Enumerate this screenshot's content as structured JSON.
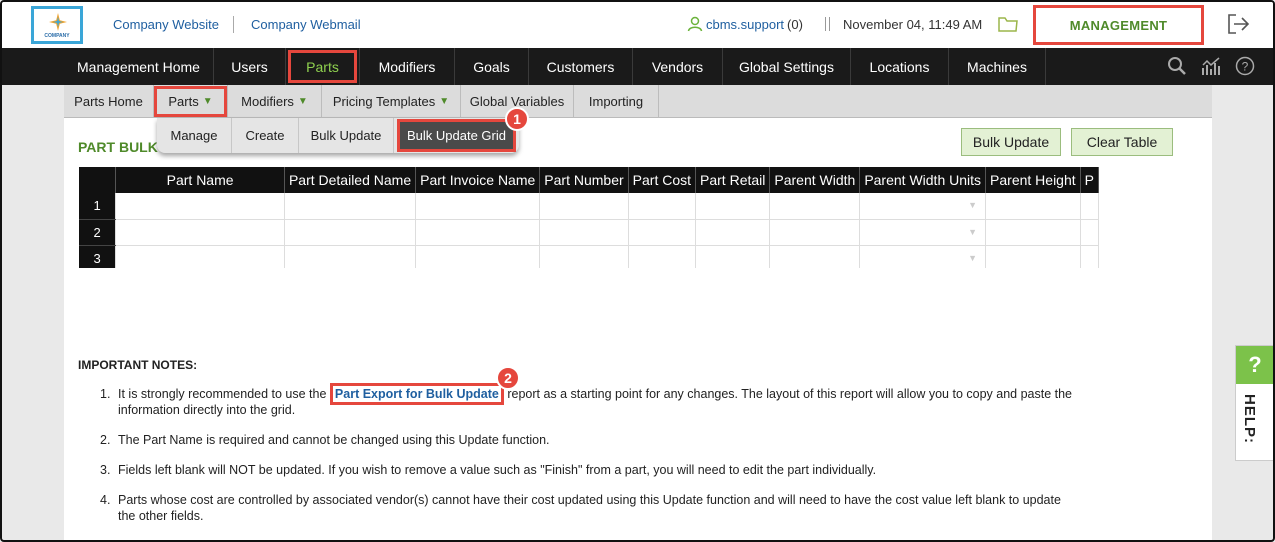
{
  "header": {
    "logo_text": "COMPANY",
    "links": [
      "Company Website",
      "Company Webmail"
    ],
    "user_name": "cbms.support",
    "user_count": "(0)",
    "datetime": "November 04, 11:49 AM",
    "management_label": "MANAGEMENT"
  },
  "mainnav": {
    "items": [
      "Management Home",
      "Users",
      "Parts",
      "Modifiers",
      "Goals",
      "Customers",
      "Vendors",
      "Global Settings",
      "Locations",
      "Machines"
    ],
    "active": "Parts"
  },
  "subnav": {
    "items": [
      "Parts Home",
      "Parts",
      "Modifiers",
      "Pricing Templates",
      "Global Variables",
      "Importing"
    ]
  },
  "dropdown": {
    "items": [
      "Manage",
      "Create",
      "Bulk Update",
      "Bulk Update Grid"
    ],
    "active": "Bulk Update Grid"
  },
  "page": {
    "title": "PART BULK",
    "bulk_update_button": "Bulk Update",
    "clear_table_button": "Clear Table"
  },
  "grid": {
    "columns": [
      "Part Name",
      "Part Detailed Name",
      "Part Invoice Name",
      "Part Number",
      "Part Cost",
      "Part Retail",
      "Parent Width",
      "Parent Width Units",
      "Parent Height",
      "P"
    ],
    "rows": [
      "1",
      "2",
      "3"
    ]
  },
  "notes": {
    "title": "IMPORTANT NOTES:",
    "items": [
      {
        "num": "1.",
        "before": "It is strongly recommended to use the",
        "link": "Part Export for Bulk Update",
        "after": "report as a starting point for any changes. The layout of this report will allow you to copy and paste the information directly into the grid."
      },
      {
        "num": "2.",
        "text": "The Part Name is required and cannot be changed using this Update function."
      },
      {
        "num": "3.",
        "text": "Fields left blank will NOT be updated. If you wish to remove a value such as \"Finish\" from a part, you will need to edit the part individually."
      },
      {
        "num": "4.",
        "text": "Parts whose cost are controlled by associated vendor(s) cannot have their cost updated using this Update function and will need to have the cost value left blank to update the other fields."
      }
    ]
  },
  "badges": [
    "1",
    "2"
  ],
  "help": {
    "icon": "?",
    "label": "HELP:"
  },
  "colors": {
    "accent_green": "#4f8a2a",
    "highlight_red": "#e5473d",
    "nav_bg": "#1a1a1a"
  }
}
